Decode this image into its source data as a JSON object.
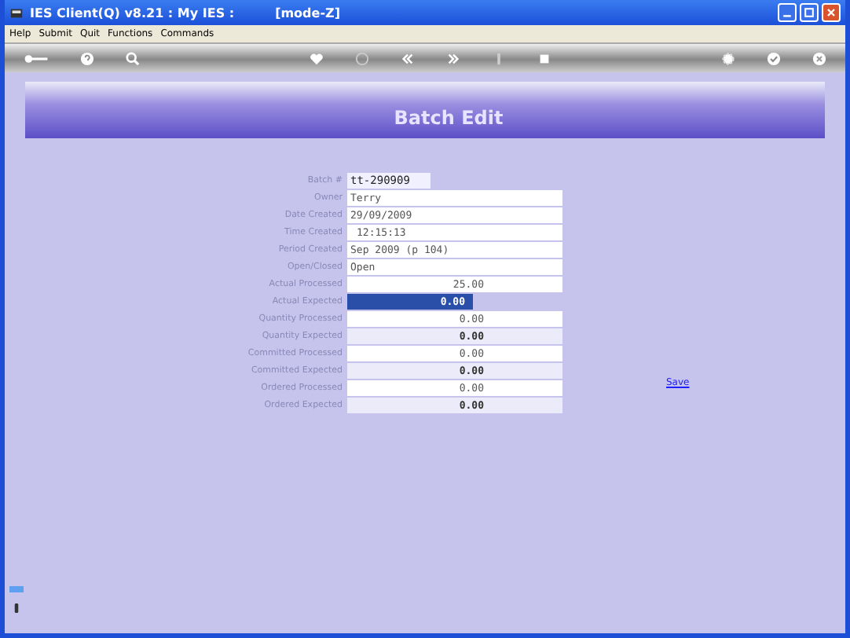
{
  "window": {
    "title": "IES Client(Q) v8.21 : My IES :",
    "mode": "[mode-Z]"
  },
  "menu": [
    "Help",
    "Submit",
    "Quit",
    "Functions",
    "Commands"
  ],
  "banner": {
    "title": "Batch Edit"
  },
  "fields": [
    {
      "label": "Batch #",
      "value": "tt-290909",
      "kind": "id",
      "selected": false
    },
    {
      "label": "Owner",
      "value": "Terry",
      "kind": "text",
      "selected": false
    },
    {
      "label": "Date Created",
      "value": "29/09/2009",
      "kind": "text",
      "selected": false
    },
    {
      "label": "Time Created",
      "value": "12:15:13",
      "kind": "time",
      "selected": false
    },
    {
      "label": "Period Created",
      "value": "Sep 2009 (p 104)",
      "kind": "text",
      "selected": false
    },
    {
      "label": "Open/Closed",
      "value": "Open",
      "kind": "text",
      "selected": false
    },
    {
      "label": "Actual Processed",
      "value": "25.00",
      "kind": "number",
      "selected": false
    },
    {
      "label": "Actual Expected",
      "value": "0.00",
      "kind": "total",
      "selected": true
    },
    {
      "label": "Quantity Processed",
      "value": "0.00",
      "kind": "number",
      "selected": false
    },
    {
      "label": "Quantity Expected",
      "value": "0.00",
      "kind": "total",
      "selected": false
    },
    {
      "label": "Committed Processed",
      "value": "0.00",
      "kind": "number",
      "selected": false
    },
    {
      "label": "Committed Expected",
      "value": "0.00",
      "kind": "total",
      "selected": false
    },
    {
      "label": "Ordered Processed",
      "value": "0.00",
      "kind": "number",
      "selected": false
    },
    {
      "label": "Ordered Expected",
      "value": "0.00",
      "kind": "total",
      "selected": false
    }
  ],
  "save_link": "Save"
}
